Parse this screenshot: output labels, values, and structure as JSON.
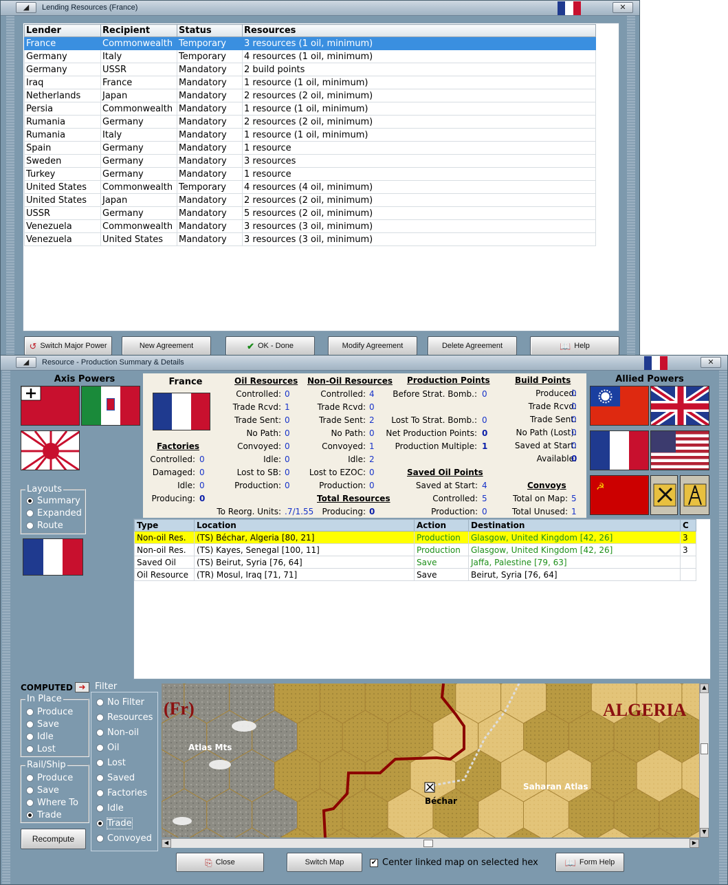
{
  "lending_window": {
    "title": "Lending Resources (France)",
    "columns": [
      "Lender",
      "Recipient",
      "Status",
      "Resources"
    ],
    "rows": [
      [
        "France",
        "Commonwealth",
        "Temporary",
        "3 resources (1 oil, minimum)"
      ],
      [
        "Germany",
        "Italy",
        "Temporary",
        "4 resources (1 oil, minimum)"
      ],
      [
        "Germany",
        "USSR",
        "Mandatory",
        "2 build points"
      ],
      [
        "Iraq",
        "France",
        "Mandatory",
        "1 resource (1 oil, minimum)"
      ],
      [
        "Netherlands",
        "Japan",
        "Mandatory",
        "2 resources (2 oil, minimum)"
      ],
      [
        "Persia",
        "Commonwealth",
        "Mandatory",
        "1 resource (1 oil, minimum)"
      ],
      [
        "Rumania",
        "Germany",
        "Mandatory",
        "2 resources (2 oil, minimum)"
      ],
      [
        "Rumania",
        "Italy",
        "Mandatory",
        "1 resource (1 oil, minimum)"
      ],
      [
        "Spain",
        "Germany",
        "Mandatory",
        "1 resource"
      ],
      [
        "Sweden",
        "Germany",
        "Mandatory",
        "3 resources"
      ],
      [
        "Turkey",
        "Germany",
        "Mandatory",
        "1 resource"
      ],
      [
        "United States",
        "Commonwealth",
        "Temporary",
        "4 resources (4 oil, minimum)"
      ],
      [
        "United States",
        "Japan",
        "Mandatory",
        "2 resources (2 oil, minimum)"
      ],
      [
        "USSR",
        "Germany",
        "Mandatory",
        "5 resources (2 oil, minimum)"
      ],
      [
        "Venezuela",
        "Commonwealth",
        "Mandatory",
        "3 resources (3 oil, minimum)"
      ],
      [
        "Venezuela",
        "United States",
        "Mandatory",
        "3 resources (3 oil, minimum)"
      ]
    ],
    "buttons": {
      "switch": "Switch Major Power",
      "new": "New Agreement",
      "ok": "OK - Done",
      "modify": "Modify Agreement",
      "delete": "Delete Agreement",
      "help": "Help"
    }
  },
  "production_window": {
    "title": "Resource - Production Summary & Details",
    "axis_title": "Axis Powers",
    "allied_title": "Allied Powers",
    "country": "France",
    "layouts": {
      "label": "Layouts",
      "options": [
        "Summary",
        "Expanded",
        "Route"
      ],
      "selected": "Summary"
    },
    "oil_resources": {
      "title": "Oil Resources",
      "rows": [
        [
          "Controlled:",
          "0"
        ],
        [
          "Trade Rcvd:",
          "1"
        ],
        [
          "Trade Sent:",
          "0"
        ],
        [
          "No Path:",
          "0"
        ],
        [
          "Convoyed:",
          "0"
        ],
        [
          "Idle:",
          "0"
        ],
        [
          "Lost to SB:",
          "0"
        ],
        [
          "Production:",
          "0"
        ]
      ],
      "reorg_label": "To Reorg. Units:",
      "reorg_value": ".7/1.55"
    },
    "non_oil_resources": {
      "title": "Non-Oil Resources",
      "rows": [
        [
          "Controlled:",
          "4"
        ],
        [
          "Trade Rcvd:",
          "0"
        ],
        [
          "Trade Sent:",
          "2"
        ],
        [
          "No Path:",
          "0"
        ],
        [
          "Convoyed:",
          "1"
        ],
        [
          "Idle:",
          "2"
        ],
        [
          "Lost to EZOC:",
          "0"
        ],
        [
          "Production:",
          "0"
        ]
      ]
    },
    "total_resources": {
      "title": "Total Resources",
      "label": "Producing:",
      "value": "0"
    },
    "factories": {
      "title": "Factories",
      "rows": [
        [
          "Controlled:",
          "0"
        ],
        [
          "Damaged:",
          "0"
        ],
        [
          "Idle:",
          "0"
        ],
        [
          "Producing:",
          "0"
        ]
      ]
    },
    "production_points": {
      "title": "Production Points",
      "rows": [
        [
          "Before Strat. Bomb.:",
          "0"
        ],
        [
          "Lost To Strat. Bomb.:",
          "0"
        ],
        [
          "Net Production Points:",
          "0"
        ],
        [
          "Production Multiple:",
          "1"
        ]
      ]
    },
    "saved_oil_points": {
      "title": "Saved Oil Points",
      "rows": [
        [
          "Saved at Start:",
          "4"
        ],
        [
          "Controlled:",
          "5"
        ],
        [
          "Production:",
          "0"
        ]
      ]
    },
    "build_points": {
      "title": "Build Points",
      "rows": [
        [
          "Produced:",
          "0"
        ],
        [
          "Trade Rcvd:",
          "0"
        ],
        [
          "Trade Sent:",
          "0"
        ],
        [
          "No Path (Lost):",
          "0"
        ],
        [
          "Saved at Start:",
          "0"
        ],
        [
          "Available:",
          "0"
        ]
      ]
    },
    "convoys": {
      "title": "Convoys",
      "rows": [
        [
          "Total on Map:",
          "5"
        ],
        [
          "Total Unused:",
          "1"
        ]
      ]
    },
    "details": {
      "columns": [
        "Type",
        "Location",
        "Action",
        "Destination",
        "C"
      ],
      "rows": [
        [
          "Non-oil Res.",
          "(TS) Béchar, Algeria [80, 21]",
          "Production",
          "Glasgow, United Kingdom [42, 26]",
          "3"
        ],
        [
          "Non-oil Res.",
          "(TS) Kayes, Senegal [100, 11]",
          "Production",
          "Glasgow, United Kingdom [42, 26]",
          "3"
        ],
        [
          "Saved Oil",
          "(TS) Beirut, Syria [76, 64]",
          "Save",
          "Jaffa, Palestine [79, 63]",
          ""
        ],
        [
          "Oil Resource",
          "(TR) Mosul, Iraq [71, 71]",
          "Save",
          "Beirut, Syria [76, 64]",
          ""
        ]
      ]
    },
    "computed_label": "COMPUTED",
    "in_place": {
      "label": "In Place",
      "options": [
        "Produce",
        "Save",
        "Idle",
        "Lost"
      ]
    },
    "rail_ship": {
      "label": "Rail/Ship",
      "options": [
        "Produce",
        "Save",
        "Where To",
        "Trade"
      ],
      "selected": "Trade"
    },
    "filter": {
      "label": "Filter",
      "options": [
        "No Filter",
        "Resources",
        "Non-oil",
        "Oil",
        "Lost",
        "Saved",
        "Factories",
        "Idle",
        "Trade",
        "Convoyed"
      ],
      "selected": "Trade"
    },
    "recompute": "Recompute",
    "map": {
      "country_tag": "(Fr)",
      "region": "ALGERIA",
      "labels": [
        "Atlas Mts",
        "Saharan Atlas",
        "Béchar"
      ]
    },
    "bottom": {
      "close": "Close",
      "switch_map": "Switch Map",
      "center_checkbox": "Center linked map on selected hex",
      "form_help": "Form Help"
    },
    "colors": {
      "selected_row": "#3a8fe0",
      "highlight_row": "#ffff00",
      "value_blue": "#1733c9",
      "action_green": "#1d8f1a",
      "border_red": "#8b0000"
    }
  }
}
